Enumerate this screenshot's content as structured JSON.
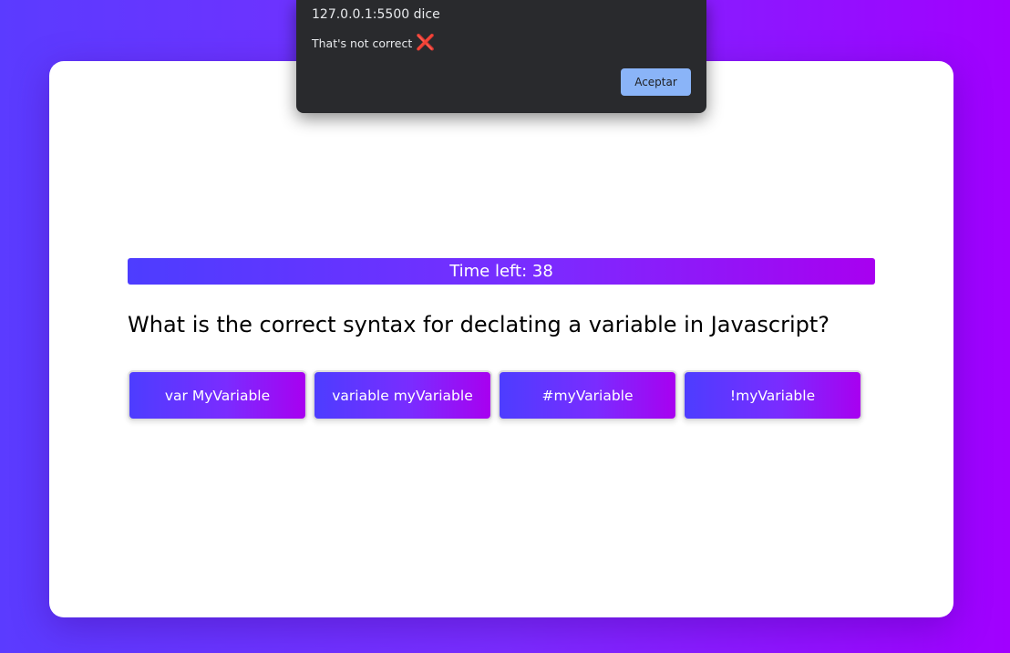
{
  "dialog": {
    "title": "127.0.0.1:5500 dice",
    "message": "That's not correct",
    "message_icon": "❌",
    "accept_label": "Aceptar"
  },
  "quiz": {
    "timer_text": "Time left: 38",
    "question": "What is the correct syntax for declating a variable in Javascript?",
    "answers": [
      {
        "label": "var MyVariable"
      },
      {
        "label": "variable myVariable"
      },
      {
        "label": "#myVariable"
      },
      {
        "label": "!myVariable"
      }
    ]
  },
  "colors": {
    "gradient_start": "#4d3dff",
    "gradient_end": "#a800f0",
    "dialog_bg": "#292a2d",
    "accept_button": "#8ab4f8"
  }
}
